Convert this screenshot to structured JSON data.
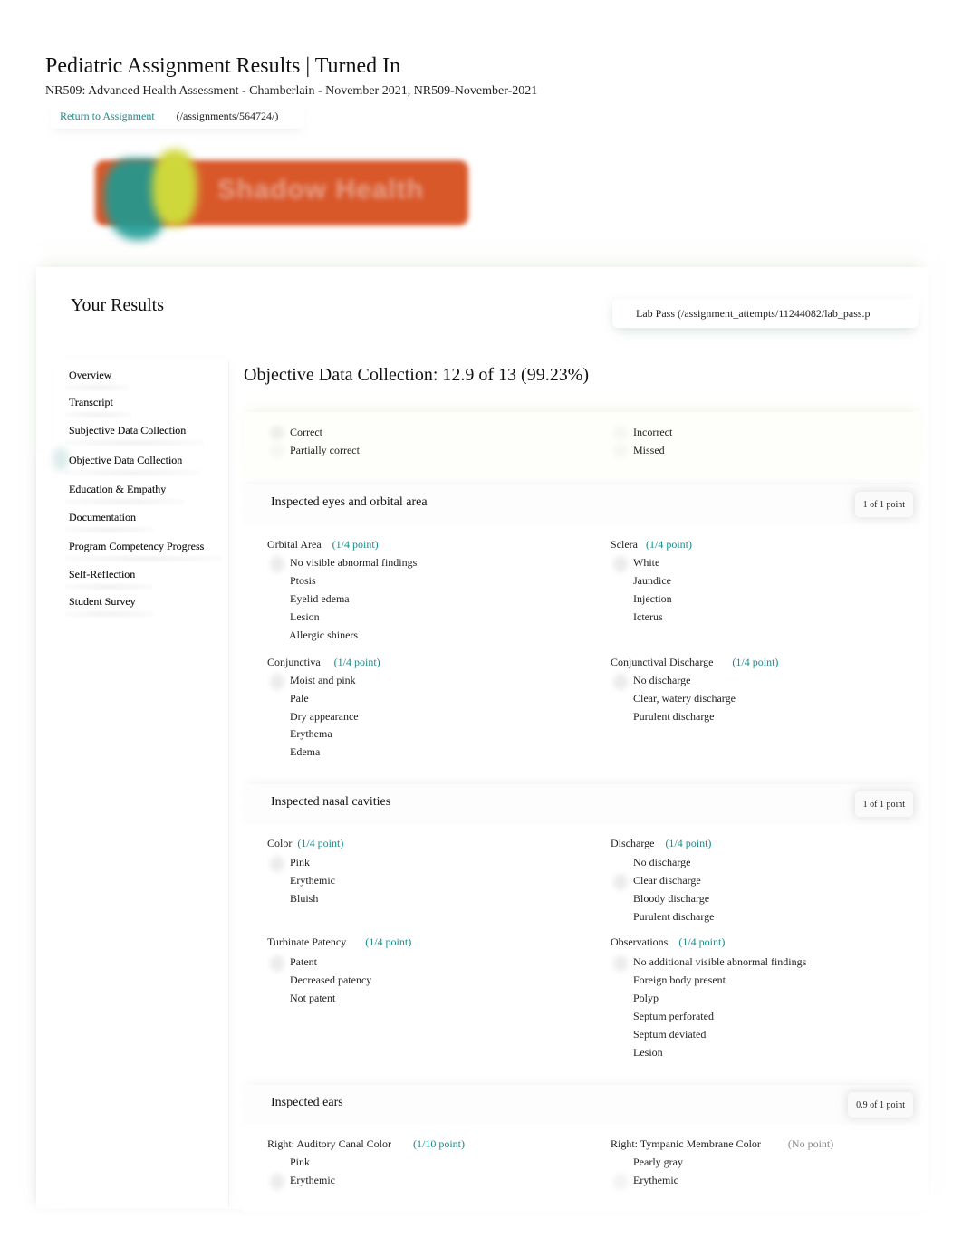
{
  "header": {
    "title": "Pediatric Assignment Results | Turned In",
    "subtitle": "NR509: Advanced Health Assessment - Chamberlain - November 2021, NR509-November-2021",
    "return_link": "Return to Assignment",
    "return_url": "(/assignments/564724/)"
  },
  "logo": {
    "text": "Shadow Health",
    "colors": {
      "bar": "#d9582a",
      "teal": "#1e9a93",
      "yellow": "#cfd83a"
    }
  },
  "results": {
    "title": "Your Results",
    "lab_pass": "Lab Pass (/assignment_attempts/11244082/lab_pass.p"
  },
  "sidebar": {
    "items": [
      {
        "label": "Overview"
      },
      {
        "label": "Transcript"
      },
      {
        "label": "Subjective Data Collection"
      },
      {
        "label": "Objective Data Collection",
        "active": true
      },
      {
        "label": "Education & Empathy"
      },
      {
        "label": "Documentation"
      },
      {
        "label": "Program Competency Progress"
      },
      {
        "label": "Self-Reflection"
      },
      {
        "label": "Student Survey"
      }
    ]
  },
  "section": {
    "title": "Objective Data Collection: 12.9 of 13 (99.23%)"
  },
  "legend": {
    "correct": "Correct",
    "partially_correct": "Partially correct",
    "incorrect": "Incorrect",
    "missed": "Missed"
  },
  "accent_color": "#1a8a8a",
  "questions": [
    {
      "title": "Inspected eyes and orbital area",
      "score": "1 of 1 point",
      "groups": [
        {
          "label": "Orbital Area",
          "points": "(1/4 point)",
          "options": [
            "No visible abnormal findings",
            "Ptosis",
            "Eyelid edema",
            "Lesion",
            "Allergic shiners"
          ]
        },
        {
          "label": "Sclera",
          "points": "(1/4 point)",
          "options": [
            "White",
            "Jaundice",
            "Injection",
            "Icterus"
          ]
        },
        {
          "label": "Conjunctiva",
          "points": "(1/4 point)",
          "options": [
            "Moist and pink",
            "Pale",
            "Dry appearance",
            "Erythema",
            "Edema"
          ]
        },
        {
          "label": "Conjunctival Discharge",
          "points": "(1/4 point)",
          "options": [
            "No discharge",
            "Clear, watery discharge",
            "Purulent discharge"
          ]
        }
      ]
    },
    {
      "title": "Inspected nasal cavities",
      "score": "1 of 1 point",
      "groups": [
        {
          "label": "Color",
          "points": "(1/4 point)",
          "options": [
            "Pink",
            "Erythemic",
            "Bluish"
          ]
        },
        {
          "label": "Discharge",
          "points": "(1/4 point)",
          "options": [
            "No discharge",
            "Clear discharge",
            "Bloody discharge",
            "Purulent discharge"
          ]
        },
        {
          "label": "Turbinate Patency",
          "points": "(1/4 point)",
          "options": [
            "Patent",
            "Decreased patency",
            "Not patent"
          ]
        },
        {
          "label": "Observations",
          "points": "(1/4 point)",
          "options": [
            "No additional visible abnormal findings",
            "Foreign body present",
            "Polyp",
            "Septum perforated",
            "Septum deviated",
            "Lesion"
          ]
        }
      ]
    },
    {
      "title": "Inspected ears",
      "score": "0.9 of 1 point",
      "groups": [
        {
          "label": "Right: Auditory Canal Color",
          "points": "(1/10 point)",
          "options": [
            "Pink",
            "Erythemic"
          ]
        },
        {
          "label": "Right: Tympanic Membrane Color",
          "points": "(No point)",
          "options": [
            "Pearly gray",
            "Erythemic"
          ]
        }
      ]
    }
  ]
}
